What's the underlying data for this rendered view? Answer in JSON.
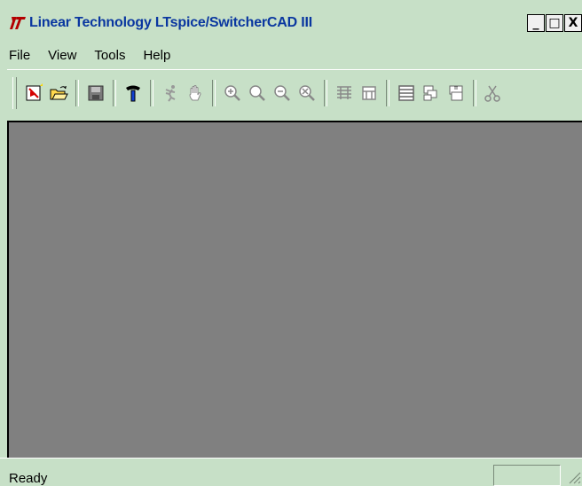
{
  "window": {
    "title": "Linear Technology LTspice/SwitcherCAD III",
    "controls": {
      "minimize": "_",
      "maximize": "□",
      "close": "X"
    }
  },
  "menubar": {
    "items": [
      {
        "label": "File"
      },
      {
        "label": "View"
      },
      {
        "label": "Tools"
      },
      {
        "label": "Help"
      }
    ]
  },
  "toolbar": {
    "icons": [
      "new-schematic-icon",
      "open-folder-icon",
      "save-icon",
      "control-panel-hammer-icon",
      "run-icon",
      "pan-hand-icon",
      "zoom-in-icon",
      "zoom-area-icon",
      "zoom-out-icon",
      "zoom-fit-icon",
      "tile-horizontal-icon",
      "tile-vertical-icon",
      "cascade-windows-icon",
      "arrange-icons-icon",
      "close-all-icon",
      "cut-icon"
    ]
  },
  "statusbar": {
    "text": "Ready"
  },
  "colors": {
    "chrome": "#c7e0c7",
    "title_text": "#0a37a0",
    "client_area": "#808080",
    "logo": "#b30000"
  }
}
